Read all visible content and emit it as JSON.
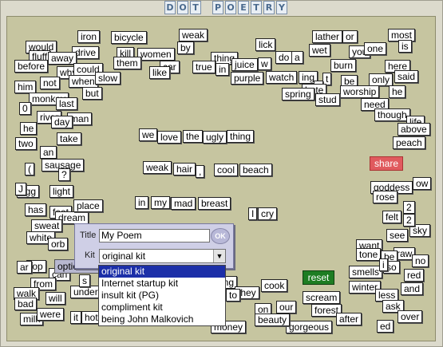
{
  "app": {
    "title_letters": [
      "D",
      "O",
      "T",
      " ",
      "P",
      "O",
      "E",
      "T",
      "R",
      "Y"
    ]
  },
  "words": [
    "would",
    "iron",
    "bicycle",
    "weak",
    "lick",
    "lather",
    "or",
    "most",
    "fluff",
    "drive",
    "kill",
    "women",
    "by",
    "thing",
    "do",
    "a",
    "wet",
    "you",
    "one",
    "is",
    "before",
    "away",
    "them",
    "car",
    "true",
    "in",
    "juice",
    "w",
    "burn",
    "here",
    "why",
    "could",
    "like",
    "purple",
    "watch",
    "ing",
    "be",
    "only",
    "said",
    "him",
    "not",
    "when",
    "slow",
    "t",
    "r",
    "hate",
    "worship",
    "he",
    "but",
    "spring",
    "stud",
    "need",
    "monkey",
    "last",
    "though",
    "0",
    "river",
    "man",
    "life",
    "he",
    "day",
    "above",
    "two",
    "take",
    "peach",
    "an",
    "sausage",
    "we",
    "love",
    "the",
    "ugly",
    "thing",
    "weak",
    "hair",
    ",",
    "cool",
    "beach",
    "egg",
    "light",
    "goddess",
    "rose",
    "has",
    "feet",
    "dream",
    "in",
    "my",
    "mad",
    "breast",
    "felt",
    "2",
    "sweat",
    "I",
    "cry",
    "see",
    "sky",
    "white",
    "orb",
    "want",
    "tone",
    "raw",
    "be",
    "top",
    "can",
    "so",
    "no",
    "red",
    "from",
    "and",
    "walk",
    "ing",
    "under",
    "they",
    "cook",
    "winter",
    "less",
    "bad",
    "will",
    "ask",
    "scream",
    "forest",
    "over",
    "milk",
    "were",
    "it",
    "hot",
    "our",
    "on",
    "gorgeous",
    "after",
    "ed",
    "beauty",
    "money",
    "smells",
    "i",
    "s",
    "place",
    "ow",
    "(",
    "?",
    "I",
    "J",
    "ar",
    "to",
    "fl",
    "2"
  ],
  "buttons": {
    "share": "share",
    "reset": "reset",
    "options": "options"
  },
  "form": {
    "title_label": "Title",
    "title_value": "My Poem",
    "ok_label": "OK",
    "kit_label": "Kit",
    "kit_selected": "original kit"
  },
  "kit_options": [
    "original kit",
    "Internet startup kit",
    "insult kit (PG)",
    "compliment kit",
    "being John Malkovich"
  ],
  "colors": {
    "board": "#c6c5a0",
    "share": "#e05a5e",
    "reset": "#1d7d22",
    "dropdown_highlight": "#1c2fa8"
  }
}
